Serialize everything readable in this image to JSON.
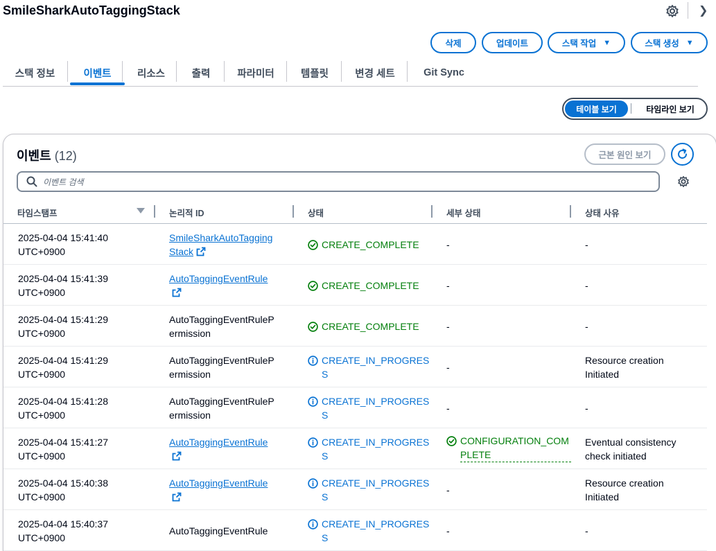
{
  "stack": {
    "title": "SmileSharkAutoTaggingStack"
  },
  "actions": {
    "delete": "삭제",
    "update": "업데이트",
    "stack_actions": "스택 작업",
    "create_stack": "스택 생성"
  },
  "tabs": [
    {
      "label": "스택 정보"
    },
    {
      "label": "이벤트"
    },
    {
      "label": "리소스"
    },
    {
      "label": "출력"
    },
    {
      "label": "파라미터"
    },
    {
      "label": "템플릿"
    },
    {
      "label": "변경 세트"
    },
    {
      "label": "Git Sync"
    }
  ],
  "view_toggle": {
    "table": "테이블 보기",
    "timeline": "타임라인 보기"
  },
  "events": {
    "title": "이벤트",
    "count": "(12)",
    "root_cause_button": "근본 원인 보기",
    "search_placeholder": "이벤트 검색",
    "columns": [
      "타임스탬프",
      "논리적 ID",
      "상태",
      "세부 상태",
      "상태 사유"
    ],
    "rows": [
      {
        "timestamp": [
          "2025-04-04 15:41:40",
          "UTC+0900"
        ],
        "logical_id": [
          "SmileSharkAutoTagging",
          "Stack"
        ],
        "is_link": true,
        "status": "CREATE_COMPLETE",
        "status_kind": "ok",
        "detail": "-",
        "reason": [
          "-"
        ]
      },
      {
        "timestamp": [
          "2025-04-04 15:41:39",
          "UTC+0900"
        ],
        "logical_id": [
          "AutoTaggingEventRule",
          ""
        ],
        "is_link": true,
        "status": "CREATE_COMPLETE",
        "status_kind": "ok",
        "detail": "-",
        "reason": [
          "-"
        ]
      },
      {
        "timestamp": [
          "2025-04-04 15:41:29",
          "UTC+0900"
        ],
        "logical_id": [
          "AutoTaggingEventRuleP",
          "ermission"
        ],
        "is_link": false,
        "status": "CREATE_COMPLETE",
        "status_kind": "ok",
        "detail": "-",
        "reason": [
          "-"
        ]
      },
      {
        "timestamp": [
          "2025-04-04 15:41:29",
          "UTC+0900"
        ],
        "logical_id": [
          "AutoTaggingEventRuleP",
          "ermission"
        ],
        "is_link": false,
        "status": "CREATE_IN_PROGRESS",
        "status_kind": "prog",
        "detail": "-",
        "reason": [
          "Resource creation",
          "Initiated"
        ]
      },
      {
        "timestamp": [
          "2025-04-04 15:41:28",
          "UTC+0900"
        ],
        "logical_id": [
          "AutoTaggingEventRuleP",
          "ermission"
        ],
        "is_link": false,
        "status": "CREATE_IN_PROGRESS",
        "status_kind": "prog",
        "detail": "-",
        "reason": [
          "-"
        ]
      },
      {
        "timestamp": [
          "2025-04-04 15:41:27",
          "UTC+0900"
        ],
        "logical_id": [
          "AutoTaggingEventRule",
          ""
        ],
        "is_link": true,
        "status": "CREATE_IN_PROGRESS",
        "status_kind": "prog",
        "detail": "CONFIGURATION_COMPLETE",
        "reason": [
          "Eventual consistency",
          "check initiated"
        ]
      },
      {
        "timestamp": [
          "2025-04-04 15:40:38",
          "UTC+0900"
        ],
        "logical_id": [
          "AutoTaggingEventRule",
          ""
        ],
        "is_link": true,
        "status": "CREATE_IN_PROGRESS",
        "status_kind": "prog",
        "detail": "-",
        "reason": [
          "Resource creation",
          "Initiated"
        ]
      },
      {
        "timestamp": [
          "2025-04-04 15:40:37",
          "UTC+0900"
        ],
        "logical_id": [
          "AutoTaggingEventRule",
          ""
        ],
        "is_link": false,
        "status": "CREATE_IN_PROGRESS",
        "status_kind": "prog",
        "detail": "-",
        "reason": [
          "-"
        ]
      }
    ]
  },
  "icons": {
    "settings": "gear-icon",
    "breadcrumb": "chevron-right-icon",
    "search": "search-icon",
    "refresh": "refresh-icon",
    "external": "external-link-icon",
    "success": "status-success-icon",
    "info": "status-info-icon"
  },
  "colors": {
    "accent": "#0972d3",
    "success": "#037f0c",
    "text": "#000716",
    "muted": "#414d5c"
  }
}
